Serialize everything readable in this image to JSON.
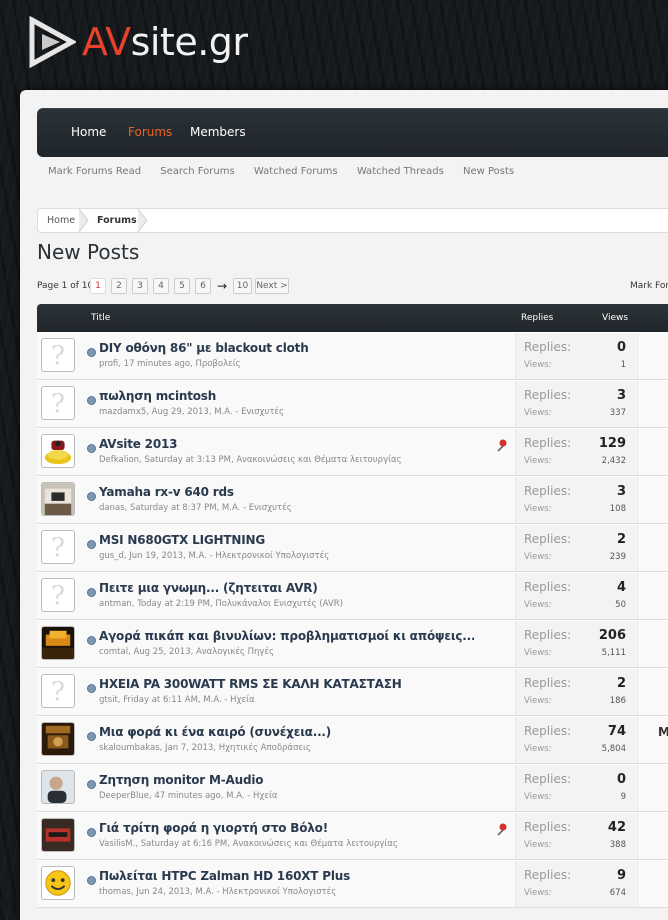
{
  "logo": {
    "av": "AV",
    "rest": "site.gr"
  },
  "nav": {
    "items": [
      "Home",
      "Forums",
      "Members"
    ],
    "active": "Forums"
  },
  "subnav": [
    "Mark Forums Read",
    "Search Forums",
    "Watched Forums",
    "Watched Threads",
    "New Posts"
  ],
  "breadcrumb": [
    "Home",
    "Forums"
  ],
  "page_title": "New Posts",
  "pager": {
    "label": "Page 1 of 10",
    "pages": [
      "1",
      "2",
      "3",
      "4",
      "5",
      "6"
    ],
    "current": "1",
    "arrow": "→",
    "last": "10",
    "next": "Next >"
  },
  "mark_forums": "Mark Foru",
  "table_head": {
    "title": "Title",
    "replies": "Replies",
    "views": "Views"
  },
  "labels": {
    "replies": "Replies:",
    "views": "Views:"
  },
  "threads": [
    {
      "title": "DIY οθόνη 86\" με blackout cloth",
      "meta": "profi, 17 minutes ago, Προβολείς",
      "replies": "0",
      "views": "1",
      "avatar": "default",
      "pinned": false,
      "last": ""
    },
    {
      "title": "πωληση mcintosh",
      "meta": "mazdamx5, Aug 29, 2013, M.A. - Ενισχυτές",
      "replies": "3",
      "views": "337",
      "avatar": "default",
      "pinned": false,
      "last": ""
    },
    {
      "title": "AVsite 2013",
      "meta": "Defkalion, Saturday at 3:13 PM, Ανακοινώσεις και Θέματα λειτουργίας",
      "replies": "129",
      "views": "2,432",
      "avatar": "gold",
      "pinned": true,
      "last": ""
    },
    {
      "title": "Yamaha rx-v 640 rds",
      "meta": "danas, Saturday at 8:37 PM, M.A. - Ενισχυτές",
      "replies": "3",
      "views": "108",
      "avatar": "room",
      "pinned": false,
      "last": ""
    },
    {
      "title": "MSI N680GTX LIGHTNING",
      "meta": "gus_d, Jun 19, 2013, M.A. - Ηλεκτρονικοί Υπολογιστές",
      "replies": "2",
      "views": "239",
      "avatar": "default",
      "pinned": false,
      "last": ""
    },
    {
      "title": "Πειτε μια γνωμη... (ζητειται AVR)",
      "meta": "antman, Today at 2:19 PM, Πολυκάναλοι Ενισχυτές (AVR)",
      "replies": "4",
      "views": "50",
      "avatar": "default",
      "pinned": false,
      "last": ""
    },
    {
      "title": "Αγορά πικάπ και βινυλίων: προβληματισμοί κι απόψεις...",
      "meta": "comtal, Aug 25, 2013, Αναλογικές Πηγές",
      "replies": "206",
      "views": "5,111",
      "avatar": "night",
      "pinned": false,
      "last": ""
    },
    {
      "title": "ΗΧΕΙΑ PA 300WATT RMS ΣΕ ΚΑΛΗ ΚΑΤΑΣΤΑΣΗ",
      "meta": "gtsit, Friday at 6:11 AM, M.A. - Ηχεία",
      "replies": "2",
      "views": "186",
      "avatar": "default",
      "pinned": false,
      "last": ""
    },
    {
      "title": "Μια φορά κι ένα καιρό (συνέχεια...)",
      "meta": "skaloumbakas, Jan 7, 2013, Ηχητικές Αποδράσεις",
      "replies": "74",
      "views": "5,804",
      "avatar": "poster",
      "pinned": false,
      "last": "M"
    },
    {
      "title": "Ζητηση monitor M-Audio",
      "meta": "DeeperBlue, 47 minutes ago, M.A. - Ηχεία",
      "replies": "0",
      "views": "9",
      "avatar": "person",
      "pinned": false,
      "last": ""
    },
    {
      "title": "Γιά τρίτη φορά η γιορτή στο Βόλο!",
      "meta": "VasilisM., Saturday at 6:16 PM, Ανακοινώσεις και Θέματα λειτουργίας",
      "replies": "42",
      "views": "388",
      "avatar": "red",
      "pinned": true,
      "last": ""
    },
    {
      "title": "Πωλείται HTPC Zalman HD 160XT Plus",
      "meta": "thomas, Jun 24, 2013, M.A. - Ηλεκτρονικοί Υπολογιστές",
      "replies": "9",
      "views": "674",
      "avatar": "smiley",
      "pinned": false,
      "last": ""
    }
  ]
}
